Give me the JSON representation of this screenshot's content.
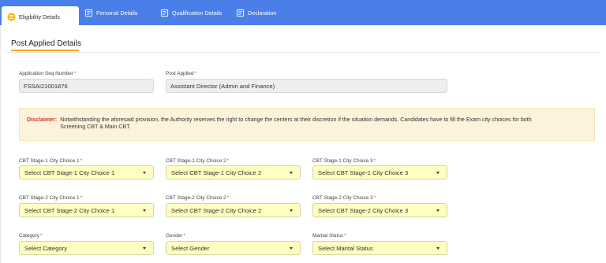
{
  "tabs": [
    {
      "label": "Eligibility Details",
      "icon": "list-circle-icon",
      "active": true
    },
    {
      "label": "Personal Details",
      "icon": "document-icon",
      "active": false
    },
    {
      "label": "Qualification Details",
      "icon": "document-icon",
      "active": false
    },
    {
      "label": "Declaration",
      "icon": "document-icon",
      "active": false
    }
  ],
  "section": {
    "title": "Post Applied Details"
  },
  "application": {
    "seq_label": "Application Seq Number",
    "seq_value": "FSSAI21001876",
    "post_label": "Post Applied",
    "post_value": "Assistant Director (Admin and Finance)"
  },
  "disclaimer": {
    "heading": "Disclaimer:",
    "line1": "Notwithstanding the aforesaid provision, the Authority reserves the right to change the centers at their discretion if the situation demands. Candidates have to fill the Exam city choices for both",
    "line2": "Screening CBT & Main CBT."
  },
  "required_mark": "*",
  "stage1": [
    {
      "label": "CBT Stage-1 City Choice 1",
      "value": "Select CBT Stage-1 City Choice 1"
    },
    {
      "label": "CBT Stage-1 City Choice 2",
      "value": "Select CBT Stage-1 City Choice 2"
    },
    {
      "label": "CBT Stage-1 City Choice 3",
      "value": "Select CBT Stage-1 City Choice 3"
    }
  ],
  "stage2": [
    {
      "label": "CBT Stage-2 City Choice 1",
      "value": "Select CBT Stage-2 City Choice 1"
    },
    {
      "label": "CBT Stage-2 City Choice 2",
      "value": "Select CBT Stage-2 City Choice 2"
    },
    {
      "label": "CBT Stage-2 City Choice 3",
      "value": "Select CBT Stage-2 City Choice 3"
    }
  ],
  "personal": [
    {
      "label": "Category",
      "value": "Select Category"
    },
    {
      "label": "Gender",
      "value": "Select Gender"
    },
    {
      "label": "Marital Status",
      "value": "Select Marital Status"
    }
  ],
  "colors": {
    "tab_bar": "#4a7ee8",
    "accent": "#f5a623",
    "required": "#e0473b",
    "select_bg": "#fefec0",
    "disclaimer_bg": "#fdf3dc"
  }
}
